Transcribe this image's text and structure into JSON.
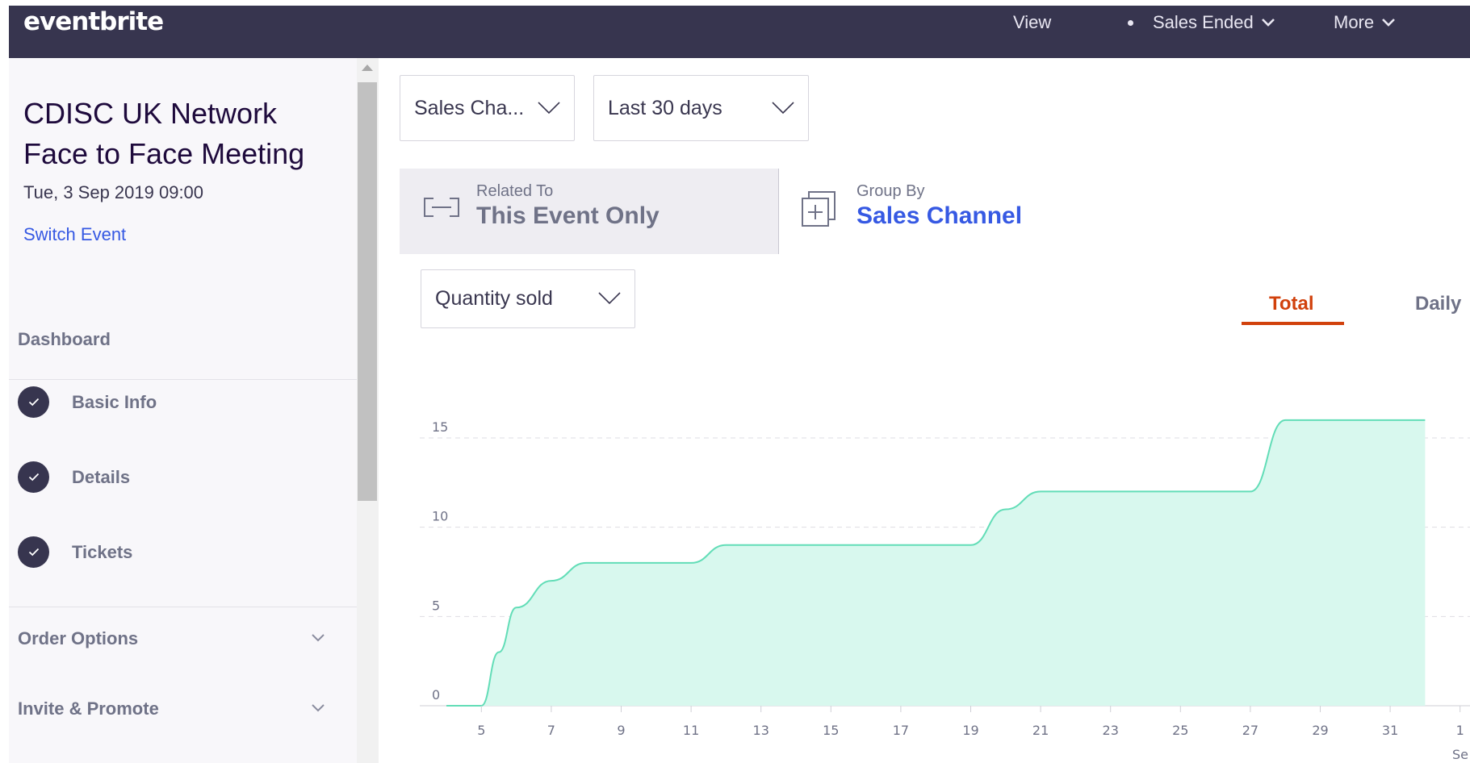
{
  "topbar": {
    "logo": "eventbrite",
    "nav": {
      "view": "View",
      "status": "Sales Ended",
      "more": "More"
    }
  },
  "sidebar": {
    "event_title": "CDISC UK Network Face to Face Meeting",
    "event_date": "Tue, 3 Sep 2019 09:00",
    "switch_event": "Switch Event",
    "dashboard": "Dashboard",
    "steps": [
      {
        "label": "Basic Info",
        "complete": true
      },
      {
        "label": "Details",
        "complete": true
      },
      {
        "label": "Tickets",
        "complete": true
      }
    ],
    "sections": [
      {
        "label": "Order Options"
      },
      {
        "label": "Invite & Promote"
      }
    ]
  },
  "filters": {
    "channel": "Sales Cha...",
    "range": "Last 30 days",
    "metric": "Quantity sold"
  },
  "related_to": {
    "caption": "Related To",
    "value": "This Event Only"
  },
  "group_by": {
    "caption": "Group By",
    "value": "Sales Channel"
  },
  "tabs": {
    "total": "Total",
    "daily": "Daily",
    "active": "total"
  },
  "colors": {
    "topbar": "#37354f",
    "accent_orange": "#d1410c",
    "link_blue": "#3659e3",
    "chart_fill": "#d8f8ee",
    "chart_line": "#62ddb7"
  },
  "chart_data": {
    "type": "area",
    "y_ticks": [
      0,
      5,
      10,
      15
    ],
    "x_ticks": [
      "5",
      "7",
      "9",
      "11",
      "13",
      "15",
      "17",
      "19",
      "21",
      "23",
      "25",
      "27",
      "29",
      "31",
      "1"
    ],
    "x_trailing_label": "Se",
    "ylim": [
      0,
      15.5
    ],
    "points": [
      {
        "day": 4,
        "value": 0
      },
      {
        "day": 5,
        "value": 0
      },
      {
        "day": 5.5,
        "value": 3
      },
      {
        "day": 6,
        "value": 5.5
      },
      {
        "day": 7,
        "value": 7
      },
      {
        "day": 8,
        "value": 8
      },
      {
        "day": 11,
        "value": 8
      },
      {
        "day": 12,
        "value": 9
      },
      {
        "day": 19,
        "value": 9
      },
      {
        "day": 20,
        "value": 11
      },
      {
        "day": 21,
        "value": 12
      },
      {
        "day": 27,
        "value": 12
      },
      {
        "day": 28,
        "value": 16
      },
      {
        "day": 32,
        "value": 16
      }
    ]
  }
}
